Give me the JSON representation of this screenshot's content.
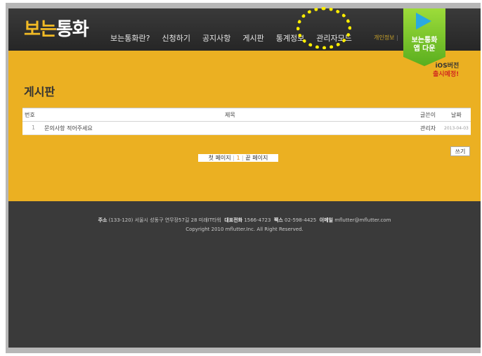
{
  "header": {
    "logo_part1": "보는",
    "logo_part2": "통화",
    "nav": [
      "보는통화란?",
      "신청하기",
      "공지사항",
      "게시판",
      "통계정보",
      "관리자모드"
    ],
    "util_link": "개인정보",
    "util_sep": "|"
  },
  "store_banner": {
    "line1": "보는통화",
    "line2": "앱 다운"
  },
  "ios_notice": {
    "line1": "iOS버전",
    "line2": "출시예정!"
  },
  "page_title": "게시판",
  "board": {
    "headers": {
      "num": "번호",
      "title": "제목",
      "author": "글쓴이",
      "date": "날짜"
    },
    "rows": [
      {
        "num": "1",
        "title": "문의사항 적어주세요",
        "author": "관리자",
        "date": "2013-04-03"
      }
    ],
    "write_button": "쓰기"
  },
  "pager": {
    "first": "첫 페이지",
    "current": "1",
    "last": "끝 페이지"
  },
  "footer": {
    "addr_label": "주소",
    "addr_value": "(133-120) 서울시 성동구 연무장57길 28 미래IT타워",
    "tel_label": "대표전화",
    "tel_value": "1566-4723",
    "fax_label": "팩스",
    "fax_value": "02-598-4425",
    "email_label": "이메일",
    "email_value": "mflutter@mflutter.com",
    "copyright": "Copyright 2010 mflutter.Inc. All Right Reserved."
  },
  "colors": {
    "brand_yellow": "#ebb022",
    "header_dark": "#2c2c2c",
    "highlight": "#ffee00"
  }
}
